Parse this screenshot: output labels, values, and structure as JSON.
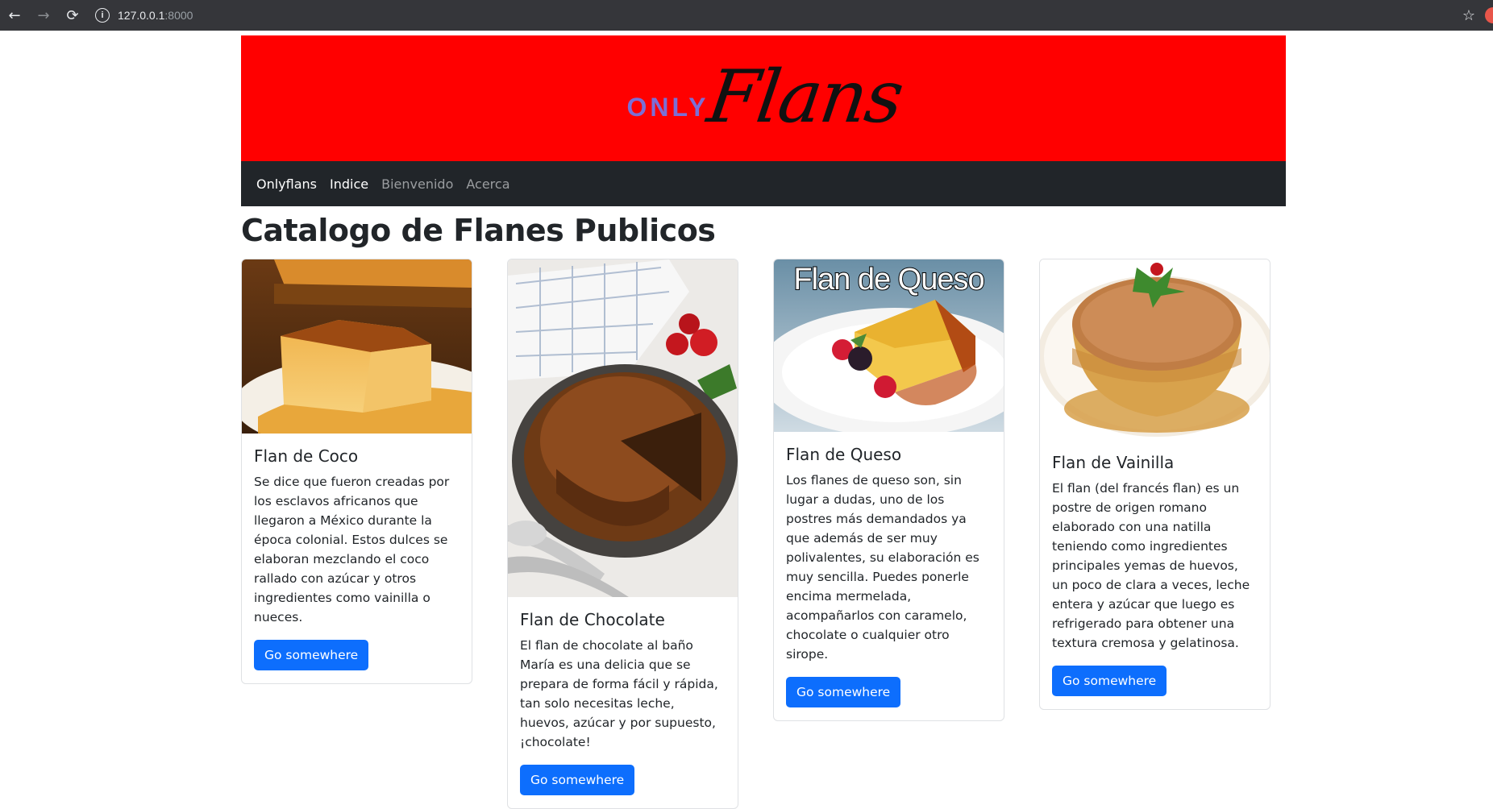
{
  "browser": {
    "back_icon": "←",
    "forward_icon": "→",
    "reload_icon": "⟳",
    "info_icon": "i",
    "url_host": "127.0.0.1",
    "url_port": ":8000",
    "bookmark_icon": "☆"
  },
  "banner": {
    "logo_only": "ONLY",
    "logo_flans": "Flans"
  },
  "navbar": {
    "brand": "Onlyflans",
    "items": [
      {
        "label": "Indice"
      },
      {
        "label": "Bienvenido"
      },
      {
        "label": "Acerca"
      }
    ]
  },
  "page_title": "Catalogo de Flanes Publicos",
  "cards": [
    {
      "title": "Flan de Coco",
      "text": "Se dice que fueron creadas por los esclavos africanos que llegaron a México durante la época colonial. Estos dulces se elaboran mezclando el coco rallado con azúcar y otros ingredientes como vainilla o nueces.",
      "button": "Go somewhere"
    },
    {
      "title": "Flan de Chocolate",
      "text": "El flan de chocolate al baño María es una delicia que se prepara de forma fácil y rápida, tan solo necesitas leche, huevos, azúcar y por supuesto, ¡chocolate!",
      "button": "Go somewhere"
    },
    {
      "title": "Flan de Queso",
      "image_caption": "Flan de Queso",
      "text": "Los flanes de queso son, sin lugar a dudas, uno de los postres más demandados ya que además de ser muy polivalentes, su elaboración es muy sencilla. Puedes ponerle encima mermelada, acompañarlos con caramelo, chocolate o cualquier otro sirope.",
      "button": "Go somewhere"
    },
    {
      "title": "Flan de Vainilla",
      "text": "El flan (del francés flan) es un postre de origen romano elaborado con una natilla teniendo como ingredientes principales yemas de huevos, un poco de clara a veces, leche entera y azúcar que luego es refrigerado para obtener una textura cremosa y gelatinosa.",
      "button": "Go somewhere"
    }
  ]
}
